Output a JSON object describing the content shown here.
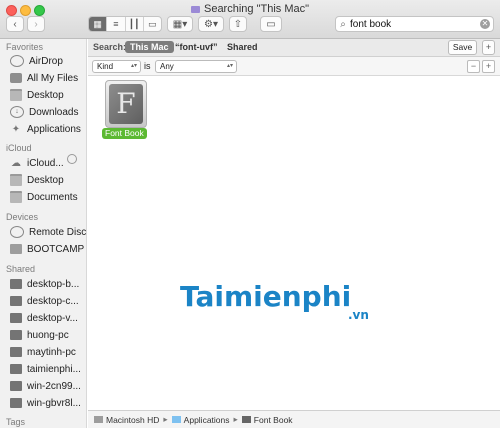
{
  "window": {
    "title": "Searching \"This Mac\""
  },
  "toolbar": {
    "search_value": "font book",
    "icons": [
      "back-icon",
      "forward-icon",
      "icon-view",
      "list-view",
      "column-view",
      "coverflow-view",
      "arrange-icon",
      "gear-icon",
      "share-icon",
      "tag-icon",
      "search-icon",
      "clear-icon"
    ]
  },
  "sidebar": {
    "favorites_header": "Favorites",
    "favorites": [
      {
        "label": "AirDrop"
      },
      {
        "label": "All My Files"
      },
      {
        "label": "Desktop"
      },
      {
        "label": "Downloads"
      },
      {
        "label": "Applications"
      }
    ],
    "icloud_header": "iCloud",
    "icloud": [
      {
        "label": "iCloud..."
      },
      {
        "label": "Desktop"
      },
      {
        "label": "Documents"
      }
    ],
    "devices_header": "Devices",
    "devices": [
      {
        "label": "Remote Disc"
      },
      {
        "label": "BOOTCAMP"
      }
    ],
    "shared_header": "Shared",
    "shared": [
      {
        "label": "desktop-b..."
      },
      {
        "label": "desktop-c..."
      },
      {
        "label": "desktop-v..."
      },
      {
        "label": "huong-pc"
      },
      {
        "label": "maytinh-pc"
      },
      {
        "label": "taimienphi..."
      },
      {
        "label": "win-2cn99..."
      },
      {
        "label": "win-gbvr8l..."
      }
    ],
    "tags_header": "Tags"
  },
  "scope": {
    "label": "Search:",
    "this_mac": "This Mac",
    "folder": "“font-uvf”",
    "shared": "Shared",
    "save": "Save",
    "plus": "+"
  },
  "criteria": {
    "attribute": "Kind",
    "is": "is",
    "value": "Any",
    "minus": "−",
    "plus": "+"
  },
  "results": [
    {
      "name": "Font Book",
      "glyph": "F"
    }
  ],
  "pathbar": [
    "Macintosh HD",
    "Applications",
    "Font Book"
  ],
  "watermark": {
    "text": "Taimienphi",
    "suffix": ".vn"
  },
  "colors": {
    "selection_label": "#5cb932",
    "watermark": "#1b84c6",
    "scope_pill": "#7d7d7d"
  }
}
